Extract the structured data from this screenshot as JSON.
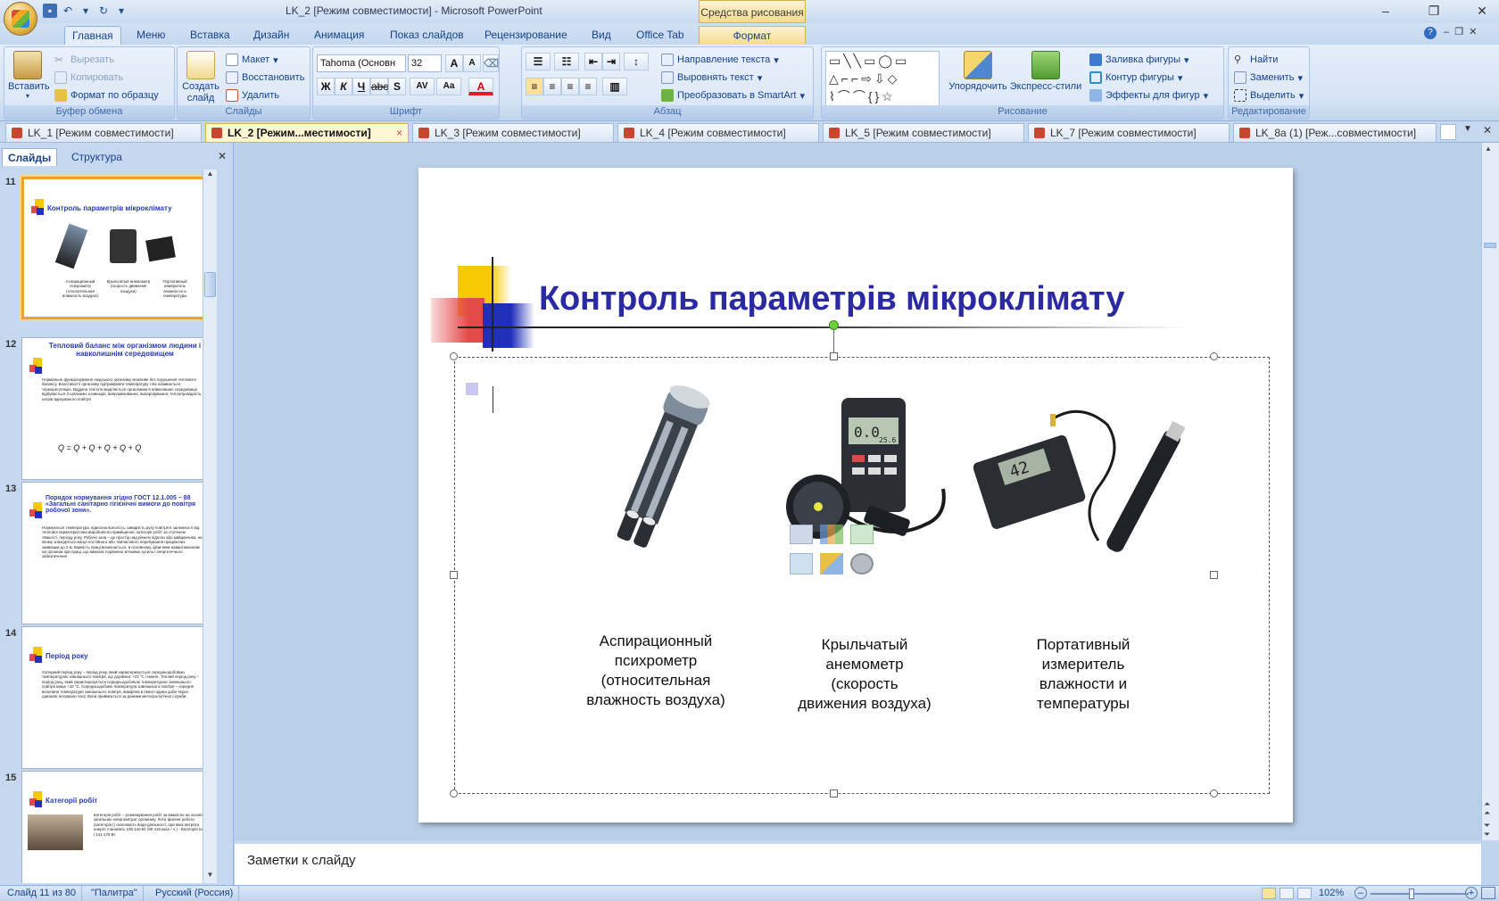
{
  "window": {
    "title": "LK_2 [Режим совместимости] - Microsoft PowerPoint",
    "context_tab_group": "Средства рисования"
  },
  "ribbon_tabs": [
    "Главная",
    "Меню",
    "Вставка",
    "Дизайн",
    "Анимация",
    "Показ слайдов",
    "Рецензирование",
    "Вид",
    "Office Tab",
    "Формат"
  ],
  "ribbon": {
    "clipboard": {
      "label": "Буфер обмена",
      "paste": "Вставить",
      "cut": "Вырезать",
      "copy": "Копировать",
      "format_painter": "Формат по образцу"
    },
    "slides": {
      "label": "Слайды",
      "new_slide": "Создать слайд",
      "layout": "Макет",
      "reset": "Восстановить",
      "delete": "Удалить"
    },
    "font": {
      "label": "Шрифт",
      "font_name": "Tahoma (Основн",
      "font_size": "32"
    },
    "paragraph": {
      "label": "Абзац",
      "text_direction": "Направление текста",
      "align_text": "Выровнять текст",
      "smartart": "Преобразовать в SmartArt"
    },
    "drawing": {
      "label": "Рисование",
      "arrange": "Упорядочить",
      "quick_styles": "Экспресс-стили",
      "shape_fill": "Заливка фигуры",
      "shape_outline": "Контур фигуры",
      "shape_effects": "Эффекты для фигур"
    },
    "editing": {
      "label": "Редактирование",
      "find": "Найти",
      "replace": "Заменить",
      "select": "Выделить"
    }
  },
  "doc_tabs": [
    {
      "label": "LK_1 [Режим совместимости]",
      "active": false
    },
    {
      "label": "LK_2 [Режим...местимости]",
      "active": true
    },
    {
      "label": "LK_3 [Режим совместимости]",
      "active": false
    },
    {
      "label": "LK_4 [Режим совместимости]",
      "active": false
    },
    {
      "label": "LK_5 [Режим совместимости]",
      "active": false
    },
    {
      "label": "LK_7 [Режим совместимости]",
      "active": false
    },
    {
      "label": "LK_8a (1) [Реж...совместимости]",
      "active": false
    }
  ],
  "left_pane": {
    "tab_slides": "Слайды",
    "tab_outline": "Структура",
    "thumbs": [
      {
        "num": "11",
        "title": "Контроль параметрів мікроклімату",
        "captions": [
          "Аспирационный психрометр (относительная влажность воздуха)",
          "Крыльчатый анемометр (скорость движения воздуха)",
          "Портативный измеритель влажности и температуры"
        ]
      },
      {
        "num": "12",
        "title": "Тепловий баланс між організмом людини і навколишнім середовищем",
        "body": "Нормальне функціонування людського організму можливе без порушення теплового балансу. Властивості організму підтримувати температуру тіла називається терморегуляцію. Віддача теплоти виділяється організмом в навколишнє середовище відбувається 3 шляхами: конвекція, випромінювання, випаровування, теплопровідність, нагрів вдихуваного повітря"
      },
      {
        "num": "13",
        "title": "Порядок нормування згідно ГОСТ 12.1.005 – 88 «Загальні санітарно гігієнічні вимоги до повітря робочої зони».",
        "body": "Нормуються температура, відносна вологість, швидкість руху повітря в залежності від: теплової характеристики виробничого приміщення, категорії робіт за ступенем тяжкості, періоду року. Робоча зона – це простір над рівнем підлоги або майданчика, на якому знаходяться місця постійного або тимчасового перебування працюючих заввишки до 2 м. Важкість праці визначається, в основному, фізичним навантаженням на організм при праці, що вимагає порівняно м'язових зусиль і енергетичного забезпечення"
      },
      {
        "num": "14",
        "title": "Період року",
        "body": "Холодний період року – період року, який характеризується середньодобовою температурою зовнішнього повітря, що дорівнює +10 °С і нижче. Теплий період року – період року, який характеризується середньодобовою температурою зовнішнього повітря вище +10 °С. Середньодобова температура зовнішнього повітря – середня величина температури зовнішнього повітря, виміряна в певні години доби через однакові інтервали часу. Вона приймається за даними метеорологічної служби."
      },
      {
        "num": "15",
        "title": "Категорії робіт",
        "body": "Категорія робіт – розмежування робіт за важкістю на основі загальних енерговитрат організму. Легкі фізичні роботи (категорія I) охоплюють види діяльності, при яких витрата енергії становить 105-140 Вт (90-120 ккал / ч.) - Категорія Іа і 141-175 Вт"
      }
    ]
  },
  "slide": {
    "title": "Контроль параметрів мікроклімату",
    "captions": [
      "Аспирационный психрометр (относительная влажность воздуха)",
      "Крыльчатый анемометр (скорость движения воздуха)",
      "Портативный измеритель влажности и температуры"
    ],
    "caption_lines": [
      [
        "Аспирационный",
        "психрометр",
        "(относительная",
        "влажность воздуха)"
      ],
      [
        "Крыльчатый",
        "анемометр",
        "(скорость",
        "движения воздуха)"
      ],
      [
        "Портативный",
        "измеритель",
        "влажности и",
        "температуры"
      ]
    ],
    "device_readouts": {
      "anemometer": "0.0",
      "anemometer_sub": "25.6",
      "hygrometer": "42"
    }
  },
  "notes_placeholder": "Заметки к слайду",
  "status": {
    "slide_counter": "Слайд 11 из 80",
    "theme": "\"Палитра\"",
    "language": "Русский (Россия)",
    "zoom": "102%"
  },
  "colors": {
    "title": "#2b2aa3",
    "accent_yellow": "#f7c900",
    "accent_red": "#e54a4a",
    "accent_blue": "#2030b8"
  }
}
